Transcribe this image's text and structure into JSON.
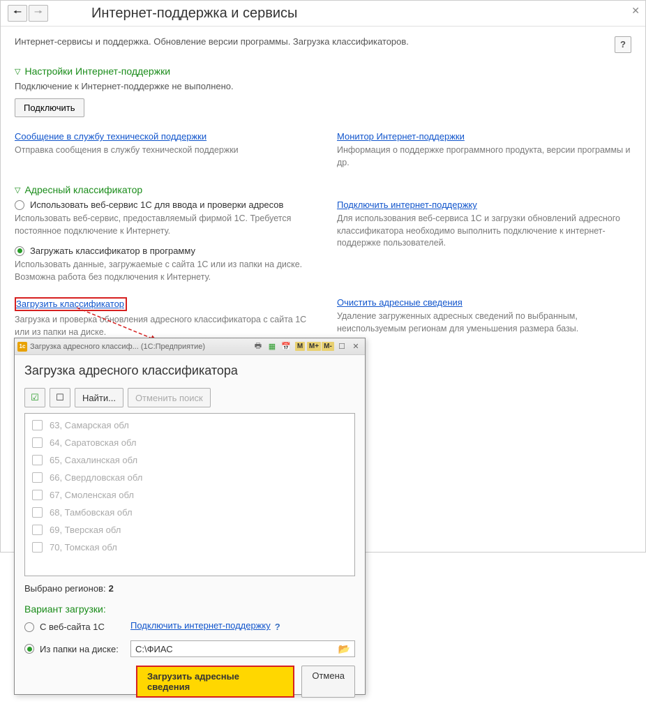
{
  "main": {
    "title": "Интернет-поддержка и сервисы",
    "subtitle": "Интернет-сервисы и поддержка. Обновление версии программы. Загрузка классификаторов.",
    "help": "?",
    "section1": {
      "title": "Настройки Интернет-поддержки",
      "desc": "Подключение к Интернет-поддержке не выполнено.",
      "connect_btn": "Подключить",
      "left_link": "Сообщение в службу технической поддержки",
      "left_desc": "Отправка сообщения в службу технической поддержки",
      "right_link": "Монитор Интернет-поддержки",
      "right_desc": "Информация о поддержке программного продукта, версии программы и др."
    },
    "section2": {
      "title": "Адресный классификатор",
      "radio1": "Использовать веб-сервис 1С для ввода и проверки адресов",
      "radio1_desc": "Использовать веб-сервис, предоставляемый фирмой 1С. Требуется постоянное подключение к Интернету.",
      "radio2": "Загружать классификатор в программу",
      "radio2_desc": "Использовать данные, загружаемые с сайта 1С или из папки на диске. Возможна работа без подключения к Интернету.",
      "right_link": "Подключить интернет-поддержку",
      "right_desc": "Для использования веб-сервиса 1С и загрузки обновлений адресного классификатора необходимо выполнить подключение к интернет-поддержке пользователей.",
      "load_link": "Загрузить классификатор",
      "load_desc": "Загрузка и проверка обновления адресного классификатора с сайта 1С или из папки на диске.",
      "clear_link": "Очистить адресные сведения",
      "clear_desc": "Удаление загруженных адресных сведений по выбранным, неиспользуемым регионам для уменьшения размера базы."
    }
  },
  "dialog": {
    "tb_title": "Загрузка адресного классиф... (1С:Предприятие)",
    "heading": "Загрузка адресного классификатора",
    "find_btn": "Найти...",
    "cancel_find_btn": "Отменить поиск",
    "regions": [
      "63, Самарская обл",
      "64, Саратовская обл",
      "65, Сахалинская обл",
      "66, Свердловская обл",
      "67, Смоленская обл",
      "68, Тамбовская обл",
      "69, Тверская обл",
      "70, Томская обл"
    ],
    "selected_label": "Выбрано регионов:",
    "selected_count": "2",
    "variant_label": "Вариант загрузки:",
    "variant1": "С веб-сайта 1С",
    "variant1_link": "Подключить интернет-поддержку",
    "variant2": "Из папки на диске:",
    "path": "С:\\ФИАС",
    "load_btn": "Загрузить адресные сведения",
    "cancel_btn": "Отмена",
    "m": "M",
    "mp": "M+",
    "mm": "M-"
  }
}
